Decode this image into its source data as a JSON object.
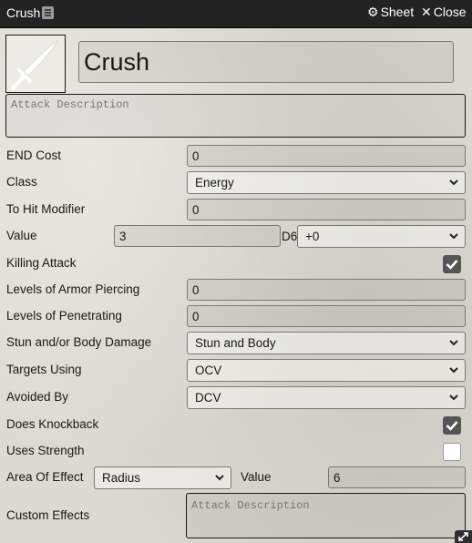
{
  "header": {
    "title": "Crush",
    "sheet_label": "Sheet",
    "close_label": "Close"
  },
  "item": {
    "name": "Crush",
    "description_placeholder": "Attack Description"
  },
  "fields": {
    "end_cost": {
      "label": "END Cost",
      "value": "0"
    },
    "class": {
      "label": "Class",
      "value": "Energy"
    },
    "to_hit_modifier": {
      "label": "To Hit Modifier",
      "value": "0"
    },
    "value": {
      "label": "Value",
      "dice": "3",
      "die_label": "D6",
      "modifier": "+0"
    },
    "killing_attack": {
      "label": "Killing Attack",
      "checked": true
    },
    "armor_piercing": {
      "label": "Levels of Armor Piercing",
      "value": "0"
    },
    "penetrating": {
      "label": "Levels of Penetrating",
      "value": "0"
    },
    "damage_type": {
      "label": "Stun and/or Body Damage",
      "value": "Stun and Body"
    },
    "targets_using": {
      "label": "Targets Using",
      "value": "OCV"
    },
    "avoided_by": {
      "label": "Avoided By",
      "value": "DCV"
    },
    "does_knockback": {
      "label": "Does Knockback",
      "checked": true
    },
    "uses_strength": {
      "label": "Uses Strength",
      "checked": false
    },
    "area_of_effect": {
      "label": "Area Of Effect",
      "shape": "Radius",
      "value_label": "Value",
      "value": "6"
    },
    "custom_effects": {
      "label": "Custom Effects",
      "placeholder": "Attack Description"
    }
  },
  "icons": {
    "sheet": "gear-icon",
    "close": "close-icon",
    "item_image": "sword-icon",
    "title": "notes-icon",
    "select_arrow": "chevron-down-icon",
    "checkbox": "check-icon",
    "resize": "resize-icon"
  },
  "colors": {
    "titlebar": "#232323",
    "checkbox_on": "#555555"
  }
}
